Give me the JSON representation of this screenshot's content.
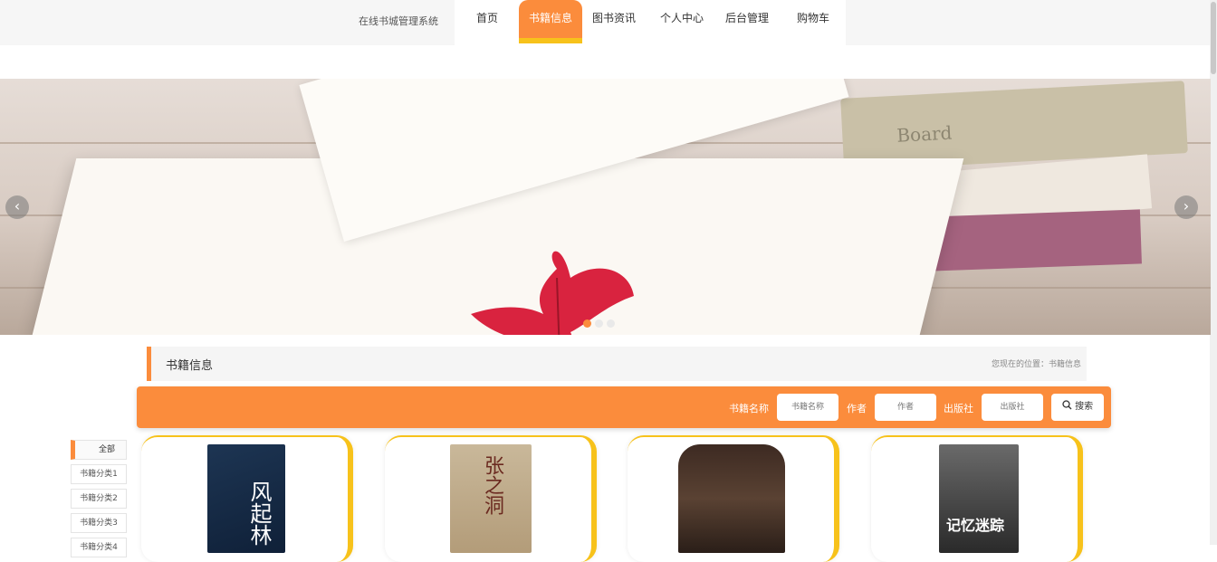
{
  "nav": {
    "site_title": "在线书城管理系统",
    "items": [
      {
        "label": "首页",
        "active": false
      },
      {
        "label": "书籍信息",
        "active": true
      },
      {
        "label": "图书资讯",
        "active": false
      },
      {
        "label": "个人中心",
        "active": false
      },
      {
        "label": "后台管理",
        "active": false
      },
      {
        "label": "购物车",
        "active": false
      }
    ]
  },
  "banner": {
    "prev_icon": "chevron-left-icon",
    "next_icon": "chevron-right-icon",
    "prev_glyph": "‹",
    "next_glyph": "›",
    "slide_count": 3,
    "active_slide": 1,
    "book_spine_text": "Board"
  },
  "section": {
    "title": "书籍信息",
    "breadcrumb": "您现在的位置：书籍信息"
  },
  "search": {
    "fields": [
      {
        "label": "书籍名称",
        "placeholder": "书籍名称"
      },
      {
        "label": "作者",
        "placeholder": "作者"
      },
      {
        "label": "出版社",
        "placeholder": "出版社"
      }
    ],
    "button_label": "搜索",
    "button_icon": "search-icon"
  },
  "categories": [
    "全部",
    "书籍分类1",
    "书籍分类2",
    "书籍分类3",
    "书籍分类4"
  ],
  "books": [
    {
      "cover_text": "风起林"
    },
    {
      "cover_text": "张之洞"
    },
    {
      "cover_text": ""
    },
    {
      "cover_text": "记忆迷踪"
    }
  ],
  "colors": {
    "accent": "#fb8c3c",
    "accent_secondary": "#f7c21b",
    "topbar": "#f6f6f6"
  }
}
